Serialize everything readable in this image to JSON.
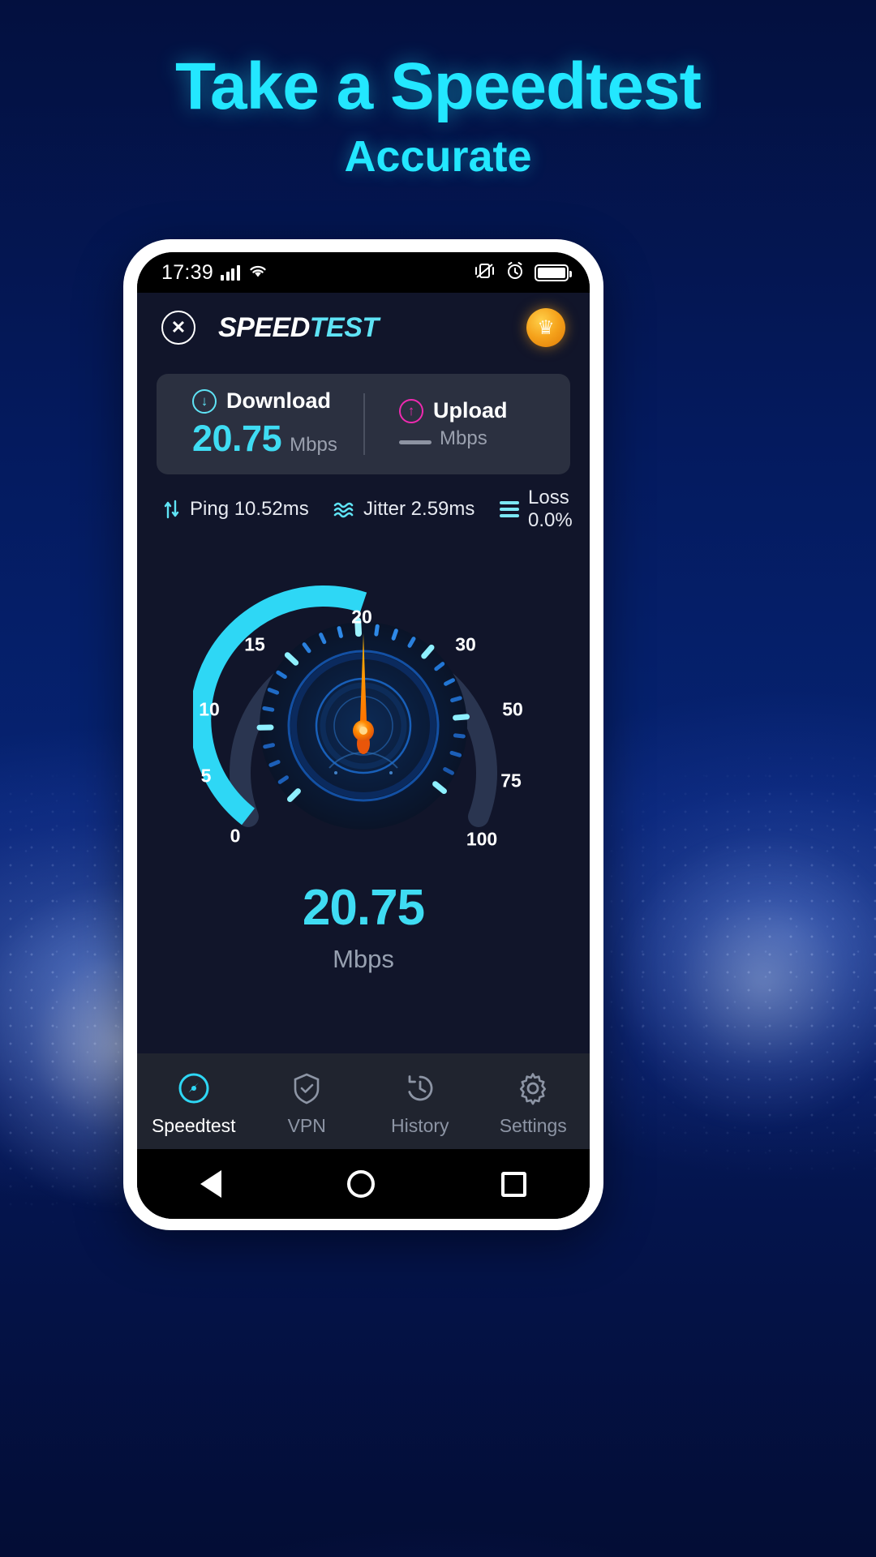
{
  "promo": {
    "headline": "Take a Speedtest",
    "subheadline": "Accurate",
    "accent_color": "#23e7ff"
  },
  "statusbar": {
    "time": "17:39",
    "icons": [
      "signal-bars-icon",
      "wifi-icon",
      "vibrate-icon",
      "alarm-icon",
      "battery-icon"
    ]
  },
  "header": {
    "close_label": "✕",
    "logo_primary": "SPEED",
    "logo_secondary": "TEST",
    "crown_label": "♛"
  },
  "results": {
    "download": {
      "label": "Download",
      "value": "20.75",
      "unit": "Mbps",
      "icon": "arrow-down-circle-icon",
      "color": "#3fdcf3"
    },
    "upload": {
      "label": "Upload",
      "value": "",
      "unit": "Mbps",
      "icon": "arrow-up-circle-icon",
      "color": "#ef2ab0"
    }
  },
  "metrics": [
    {
      "icon": "ping-arrows-icon",
      "label": "Ping 10.52ms"
    },
    {
      "icon": "jitter-wave-icon",
      "label": "Jitter 2.59ms"
    },
    {
      "icon": "loss-lines-icon",
      "label": "Loss 0.0%"
    }
  ],
  "gauge": {
    "value": "20.75",
    "unit": "Mbps",
    "needle_value": 20,
    "arc_color": "#2ed7f5",
    "needle_color": "#ff7a00",
    "ticks": [
      "0",
      "5",
      "10",
      "15",
      "20",
      "30",
      "50",
      "75",
      "100"
    ]
  },
  "bottom_nav": [
    {
      "label": "Speedtest",
      "icon": "speedometer-icon",
      "active": true
    },
    {
      "label": "VPN",
      "icon": "shield-check-icon",
      "active": false
    },
    {
      "label": "History",
      "icon": "clock-history-icon",
      "active": false
    },
    {
      "label": "Settings",
      "icon": "gear-icon",
      "active": false
    }
  ],
  "android_nav": {
    "back": "back-triangle-icon",
    "home": "home-circle-icon",
    "recents": "recents-square-icon"
  }
}
